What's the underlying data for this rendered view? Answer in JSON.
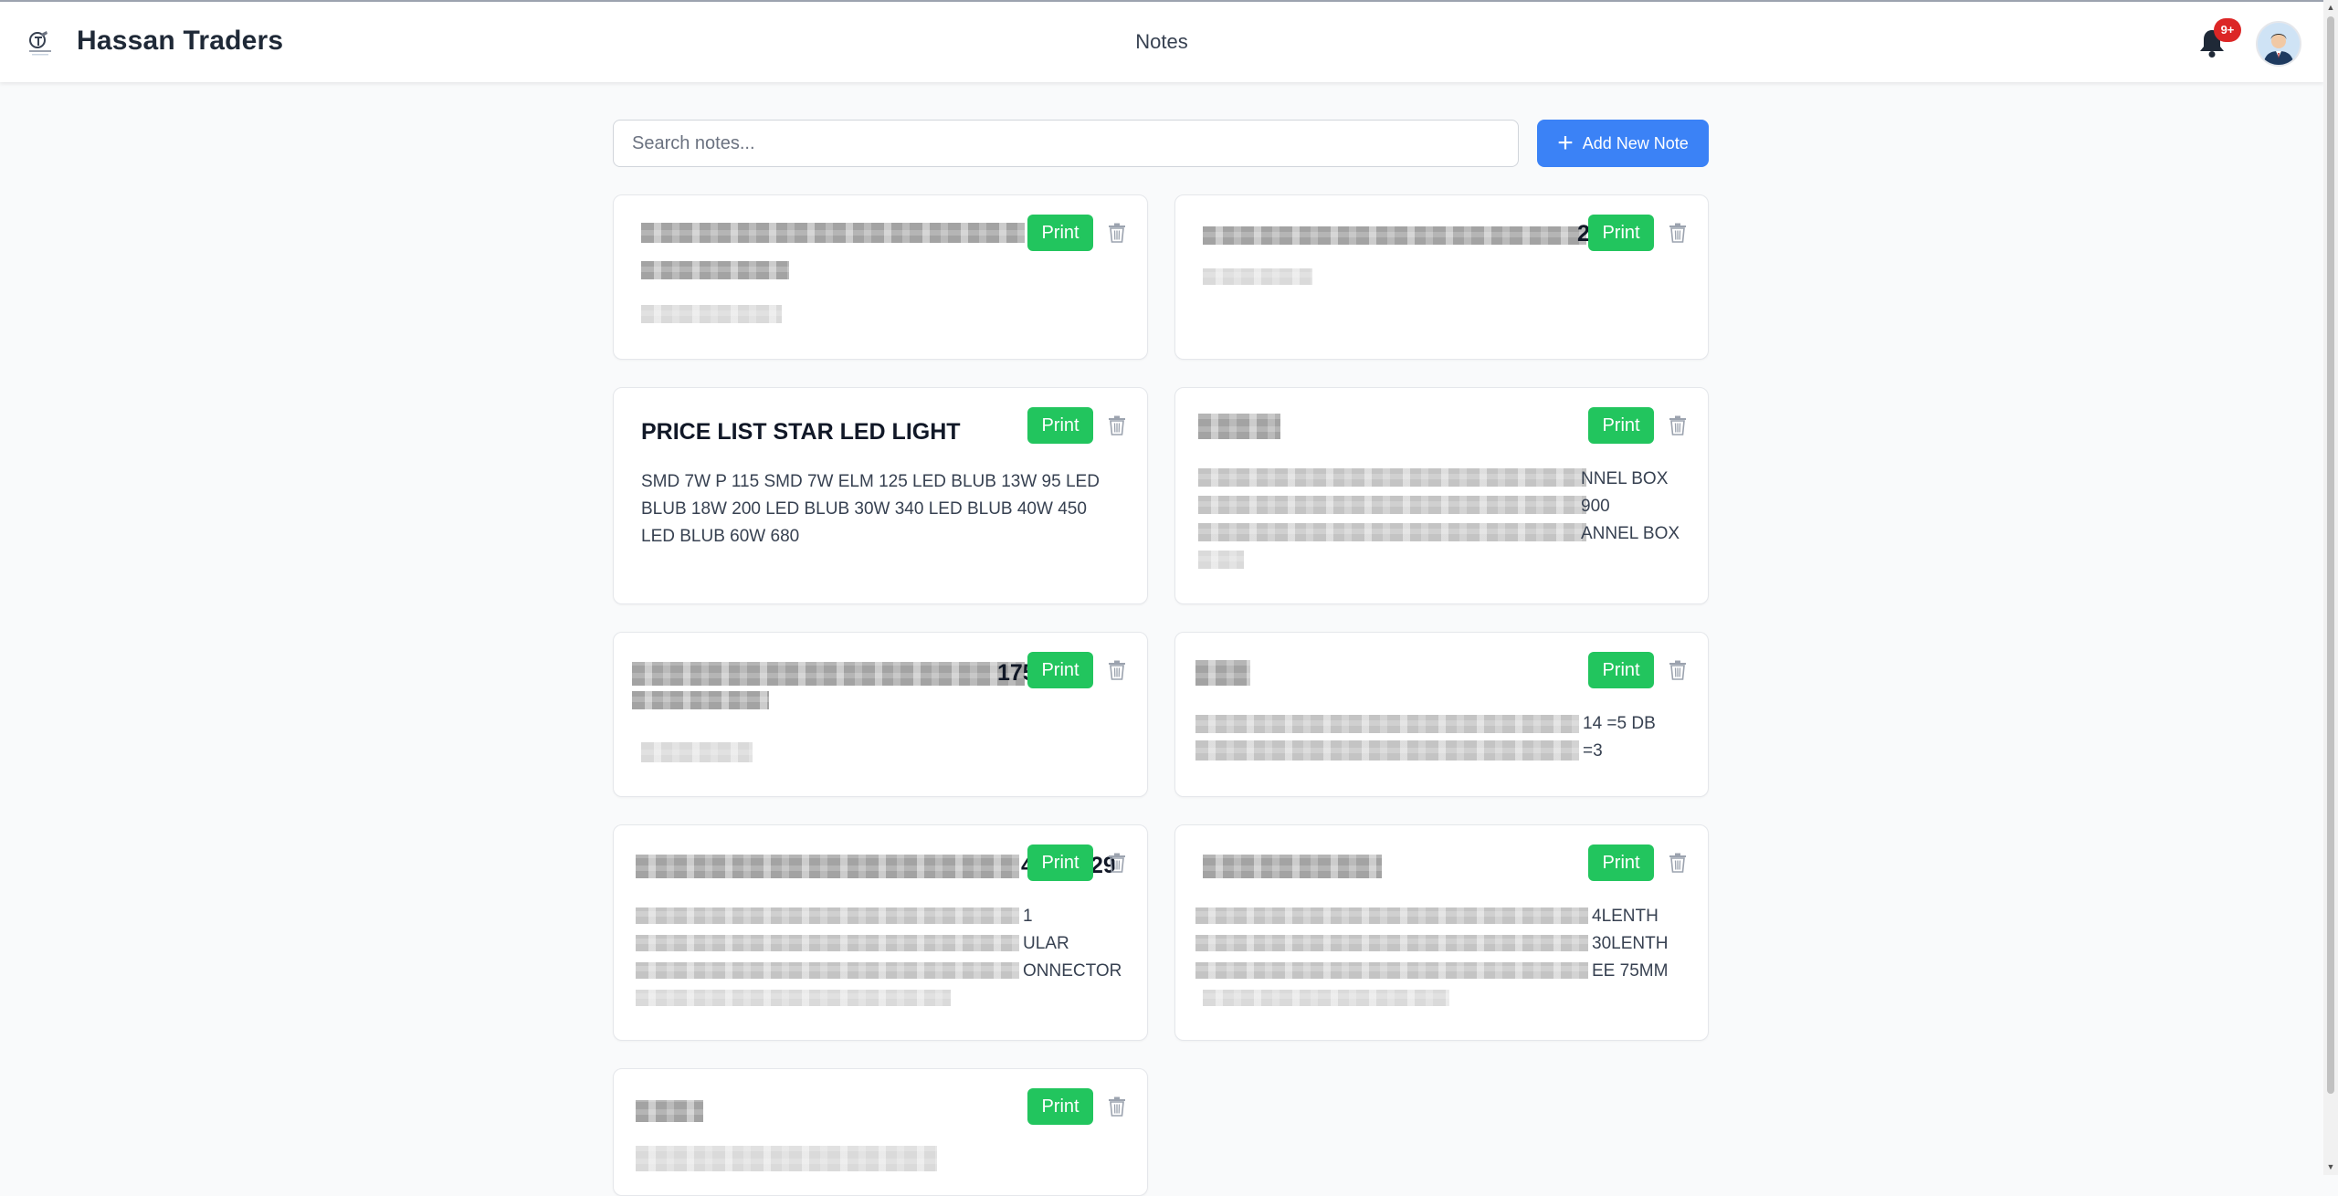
{
  "header": {
    "brand": "Hassan Traders",
    "page_title": "Notes",
    "notification_count": "9+"
  },
  "toolbar": {
    "search_placeholder": "Search notes...",
    "add_label": "Add New Note"
  },
  "note_actions": {
    "print_label": "Print"
  },
  "notes": [
    {
      "title": "",
      "body": ""
    },
    {
      "title": "",
      "body": "",
      "fragments": [
        "2"
      ]
    },
    {
      "title": "PRICE LIST STAR LED LIGHT",
      "body": "SMD 7W P 115 SMD 7W ELM 125 LED BLUB 13W 95 LED BLUB 18W 200 LED BLUB 30W 340 LED BLUB 40W 450 LED BLUB 60W 680"
    },
    {
      "title": "",
      "body": "",
      "fragments": [
        "NNEL BOX",
        "900",
        "ANNEL BOX"
      ]
    },
    {
      "title": "",
      "body": "",
      "fragments": [
        "175"
      ]
    },
    {
      "title": "",
      "body": "",
      "fragments": [
        "14 =5 DB",
        "=3"
      ]
    },
    {
      "title": "",
      "body": "",
      "fragments": [
        "4",
        "29",
        "1",
        "ULAR",
        "ONNECTOR"
      ]
    },
    {
      "title": "",
      "body": "",
      "fragments": [
        "4LENTH",
        "30LENTH",
        "EE 75MM"
      ]
    },
    {
      "title": "",
      "body": ""
    }
  ],
  "colors": {
    "accent_blue": "#3b82f6",
    "print_green": "#22c55e",
    "badge_red": "#dc2626"
  },
  "icons": [
    "logo-icon",
    "bell-icon",
    "avatar",
    "plus-icon",
    "trash-icon"
  ]
}
